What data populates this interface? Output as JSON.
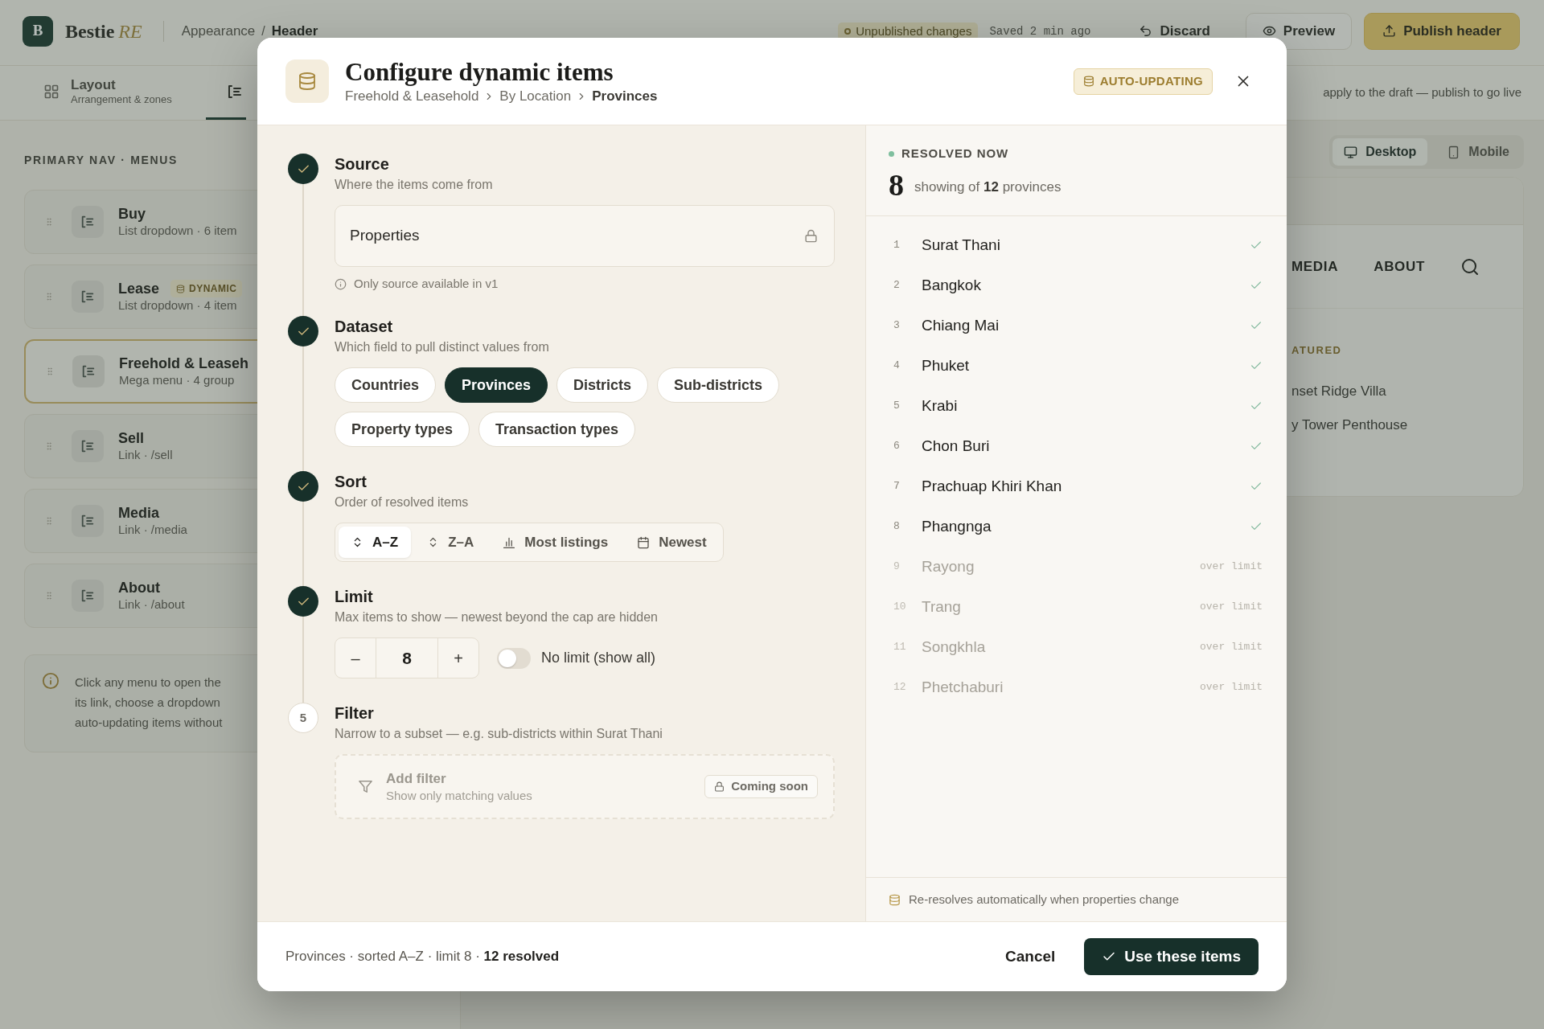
{
  "app": {
    "brand": {
      "letter": "B",
      "name": "Bestie",
      "suffix": "RE"
    },
    "breadcrumb": [
      "Appearance",
      "Header"
    ],
    "separator": "/",
    "status": "Unpublished changes",
    "saved": "Saved 2 min ago",
    "actions": [
      {
        "label": "Discard",
        "kind": "ghost"
      },
      {
        "label": "Preview",
        "kind": "outline"
      },
      {
        "label": "Publish header",
        "kind": "primary"
      }
    ],
    "tabs": [
      {
        "title": "Layout",
        "subtitle": "Arrangement & zones",
        "selected": false
      },
      {
        "selected": true
      }
    ],
    "hint": "apply to the draft — publish to go live",
    "sidebar": {
      "title": "PRIMARY NAV · MENUS",
      "menus": [
        {
          "title": "Buy",
          "subtitle": "List dropdown · 6 item",
          "selected": false
        },
        {
          "title": "Lease",
          "badge": "DYNAMIC",
          "subtitle": "List dropdown · 4 item",
          "selected": false
        },
        {
          "title": "Freehold & Leaseh",
          "subtitle": "Mega menu · 4 group",
          "selected": true
        },
        {
          "title": "Sell",
          "subtitle": "Link · /sell",
          "selected": false
        },
        {
          "title": "Media",
          "subtitle": "Link · /media",
          "selected": false
        },
        {
          "title": "About",
          "subtitle": "Link · /about",
          "selected": false
        }
      ],
      "info": [
        "Click any menu to open the",
        "its link, choose a dropdown",
        "auto-updating items without"
      ]
    },
    "preview": {
      "devices": [
        {
          "label": "Desktop",
          "selected": true
        },
        {
          "label": "Mobile",
          "selected": false
        }
      ],
      "nav": [
        "MEDIA",
        "ABOUT"
      ],
      "section": "ATURED",
      "items": [
        "nset Ridge Villa",
        "y Tower Penthouse"
      ]
    }
  },
  "modal": {
    "title": "Configure dynamic items",
    "breadcrumb": [
      "Freehold & Leasehold",
      "By Location",
      "Provinces"
    ],
    "badge": "AUTO-UPDATING",
    "steps": [
      {
        "kind": "source",
        "done": true,
        "title": "Source",
        "subtitle": "Where the items come from",
        "value": "Properties",
        "locked": true,
        "note": "Only source available in v1"
      },
      {
        "kind": "dataset",
        "done": true,
        "title": "Dataset",
        "subtitle": "Which field to pull distinct values from",
        "options": [
          {
            "label": "Countries",
            "selected": false
          },
          {
            "label": "Provinces",
            "selected": true
          },
          {
            "label": "Districts",
            "selected": false
          },
          {
            "label": "Sub-districts",
            "selected": false
          },
          {
            "label": "Property types",
            "selected": false
          },
          {
            "label": "Transaction types",
            "selected": false
          }
        ]
      },
      {
        "kind": "sort",
        "done": true,
        "title": "Sort",
        "subtitle": "Order of resolved items",
        "options": [
          {
            "label": "A–Z",
            "selected": true
          },
          {
            "label": "Z–A",
            "selected": false
          },
          {
            "label": "Most listings",
            "selected": false
          },
          {
            "label": "Newest",
            "selected": false
          }
        ]
      },
      {
        "kind": "limit",
        "done": true,
        "title": "Limit",
        "subtitle": "Max items to show — newest beyond the cap are hidden",
        "decrement": "–",
        "value": "8",
        "increment": "+",
        "toggle": {
          "label": "No limit (show all)",
          "on": false
        }
      },
      {
        "kind": "filter",
        "done": false,
        "number": "5",
        "title": "Filter",
        "subtitle": "Narrow to a subset — e.g. sub-districts within Surat Thani",
        "add": {
          "title": "Add filter",
          "subtitle": "Show only matching values"
        },
        "badge": "Coming soon"
      }
    ],
    "resolved": {
      "label": "RESOLVED NOW",
      "count": "8",
      "summary": "showing of **12** provinces",
      "items": [
        {
          "index": "1",
          "name": "Surat Thani",
          "included": true
        },
        {
          "index": "2",
          "name": "Bangkok",
          "included": true
        },
        {
          "index": "3",
          "name": "Chiang Mai",
          "included": true
        },
        {
          "index": "4",
          "name": "Phuket",
          "included": true
        },
        {
          "index": "5",
          "name": "Krabi",
          "included": true
        },
        {
          "index": "6",
          "name": "Chon Buri",
          "included": true
        },
        {
          "index": "7",
          "name": "Prachuap Khiri Khan",
          "included": true
        },
        {
          "index": "8",
          "name": "Phangnga",
          "included": true
        },
        {
          "index": "9",
          "name": "Rayong",
          "included": false,
          "note": "over limit"
        },
        {
          "index": "10",
          "name": "Trang",
          "included": false,
          "note": "over limit"
        },
        {
          "index": "11",
          "name": "Songkhla",
          "included": false,
          "note": "over limit"
        },
        {
          "index": "12",
          "name": "Phetchaburi",
          "included": false,
          "note": "over limit"
        }
      ],
      "footer": "Re-resolves automatically when properties change"
    },
    "footer": {
      "summary": "Provinces · sorted A–Z · limit 8 · **12 resolved**",
      "cancel": "Cancel",
      "confirm": "Use these items"
    }
  }
}
